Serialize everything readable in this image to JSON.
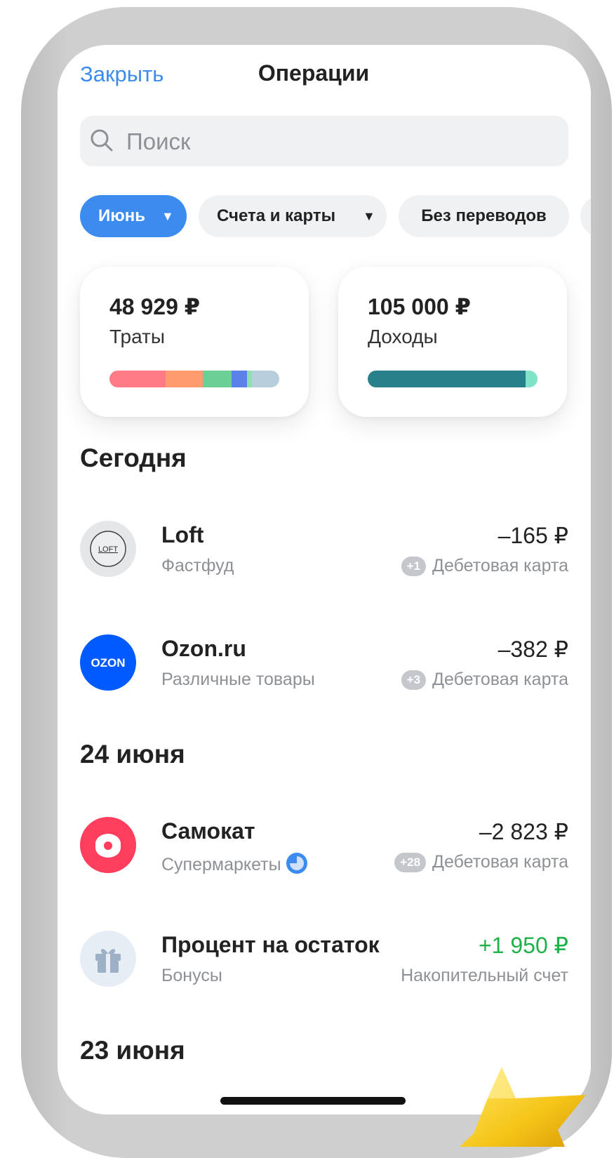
{
  "header": {
    "close_label": "Закрыть",
    "title": "Операции"
  },
  "search": {
    "placeholder": "Поиск"
  },
  "filters": {
    "month": "Июнь",
    "accounts": "Счета и карты",
    "transfers": "Без переводов"
  },
  "summary": {
    "spending": {
      "amount": "48 929 ₽",
      "label": "Траты",
      "segments": [
        {
          "share": 0.33,
          "color": "#ff7b85"
        },
        {
          "share": 0.22,
          "color": "#ff9b6e"
        },
        {
          "share": 0.17,
          "color": "#6ccf94"
        },
        {
          "share": 0.09,
          "color": "#5b82e8"
        },
        {
          "share": 0.03,
          "color": "#8fe0b0"
        },
        {
          "share": 0.16,
          "color": "#b7cedd"
        }
      ]
    },
    "income": {
      "amount": "105 000 ₽",
      "label": "Доходы",
      "segments": [
        {
          "share": 0.93,
          "color": "#27808a"
        },
        {
          "share": 0.07,
          "color": "#7fe3c6"
        }
      ]
    }
  },
  "sections": [
    {
      "title": "Сегодня",
      "operations": [
        {
          "name": "Loft",
          "category": "Фастфуд",
          "amount": "–165 ₽",
          "badge": "+1",
          "account": "Дебетовая карта",
          "logo": "loft-logo"
        },
        {
          "name": "Ozon.ru",
          "category": "Различные товары",
          "amount": "–382 ₽",
          "badge": "+3",
          "account": "Дебетовая карта",
          "logo": "ozon-logo",
          "logo_text": "OZON"
        }
      ]
    },
    {
      "title": "24 июня",
      "operations": [
        {
          "name": "Самокат",
          "category": "Супермаркеты",
          "amount": "–2 823 ₽",
          "badge": "+28",
          "account": "Дебетовая карта",
          "logo": "samokat-logo"
        },
        {
          "name": "Процент на остаток",
          "category": "Бонусы",
          "amount": "+1 950 ₽",
          "account": "Накопительный счет",
          "logo": "gift-icon"
        }
      ]
    },
    {
      "title": "23 июня"
    }
  ],
  "colors": {
    "accent": "#3c8cf0",
    "positive": "#1fb14a",
    "muted": "#8d9196"
  }
}
